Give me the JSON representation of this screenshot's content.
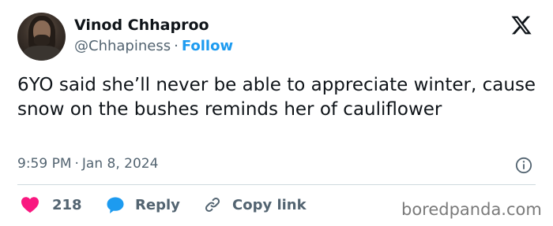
{
  "author": {
    "display_name": "Vinod Chhaproo",
    "handle": "@Chhapiness",
    "separator": "·",
    "follow_label": "Follow"
  },
  "tweet": {
    "text": "6YO said she’ll never be able to appreciate winter, cause snow on the bushes reminds her of cauliflower",
    "time": "9:59 PM",
    "date_separator": "·",
    "date": "Jan 8, 2024"
  },
  "actions": {
    "like_count": "218",
    "reply_label": "Reply",
    "copy_link_label": "Copy link"
  },
  "watermark": "boredpanda.com",
  "icons": {
    "platform": "x-logo-icon",
    "info": "info-icon",
    "like": "heart-icon",
    "reply": "speech-bubble-icon",
    "copy": "link-icon"
  },
  "colors": {
    "follow": "#1d9bf0",
    "heart": "#f91880",
    "reply_bubble": "#1d9bf0",
    "secondary_text": "#536471"
  }
}
